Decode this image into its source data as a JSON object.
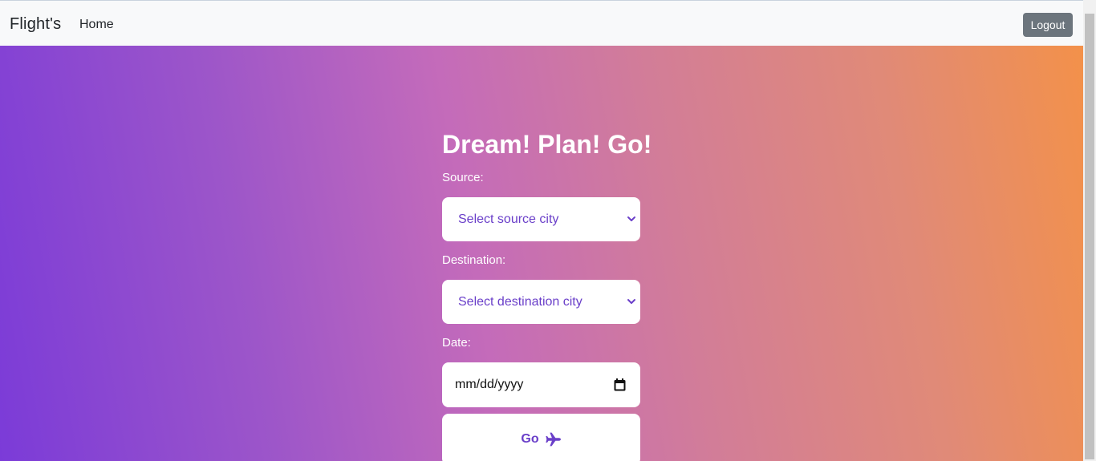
{
  "navbar": {
    "brand": "Flight's",
    "home_label": "Home",
    "logout_label": "Logout"
  },
  "hero": {
    "headline": "Dream! Plan! Go!",
    "source": {
      "label": "Source:",
      "selected": "Select source city"
    },
    "destination": {
      "label": "Destination:",
      "selected": "Select destination city"
    },
    "date": {
      "label": "Date:",
      "value": "mm/dd/yyyy"
    },
    "go_label": "Go",
    "icons": {
      "chevron": "chevron-down-icon",
      "calendar": "calendar-icon",
      "plane": "plane-icon"
    }
  },
  "colors": {
    "navbar_bg": "#f8f9fa",
    "logout_bg": "#6c757d",
    "accent_text": "#6a3fc9",
    "gradient_start": "#7b3bd8",
    "gradient_mid": "#c46bba",
    "gradient_end": "#f3914a"
  }
}
